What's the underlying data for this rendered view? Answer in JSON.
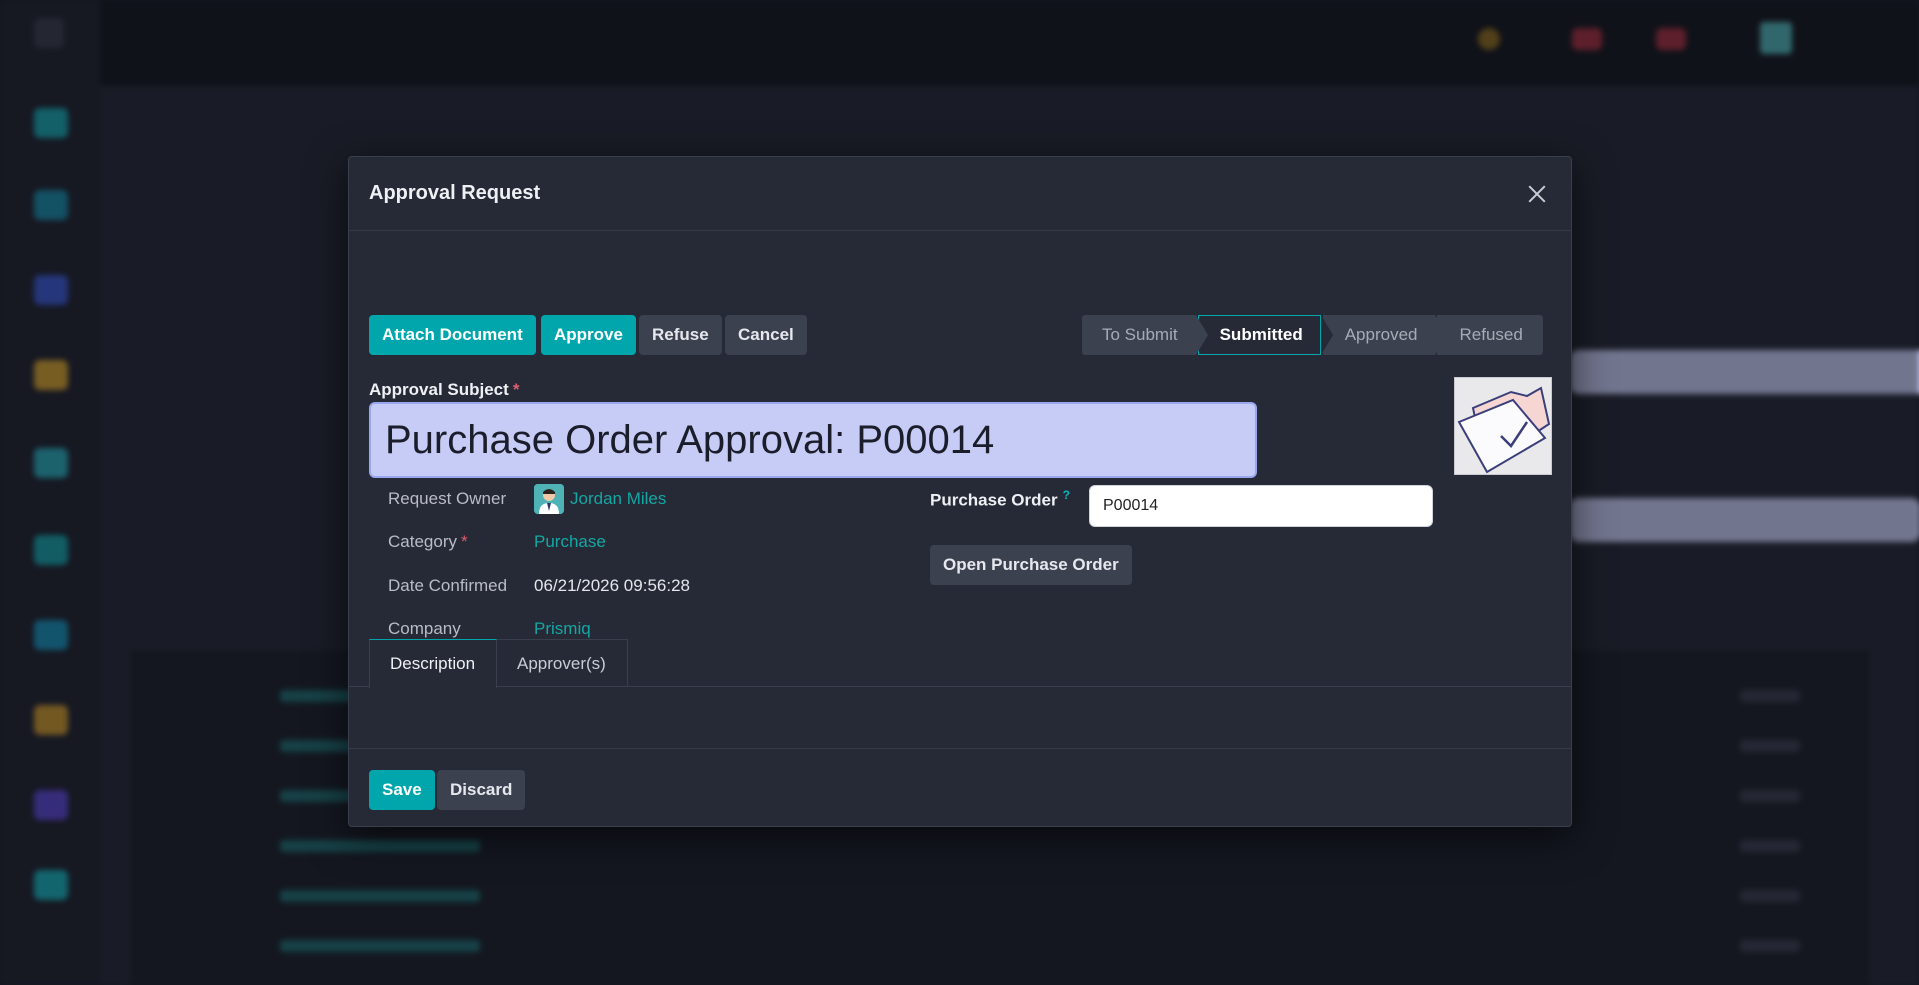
{
  "modal": {
    "title": "Approval Request"
  },
  "actions": {
    "attach_document": "Attach Document",
    "approve": "Approve",
    "refuse": "Refuse",
    "cancel": "Cancel"
  },
  "statusbar": {
    "stages": [
      "To Submit",
      "Submitted",
      "Approved",
      "Refused"
    ],
    "active": "Submitted"
  },
  "form": {
    "subject_label": "Approval Subject",
    "subject_value": "Purchase Order Approval: P00014",
    "request_owner_label": "Request Owner",
    "request_owner_value": "Jordan Miles",
    "category_label": "Category",
    "category_value": "Purchase",
    "date_confirmed_label": "Date Confirmed",
    "date_confirmed_value": "06/21/2026 09:56:28",
    "company_label": "Company",
    "company_value": "Prismiq",
    "purchase_order_label": "Purchase Order",
    "purchase_order_help": "?",
    "purchase_order_value": "P00014",
    "open_purchase_order": "Open Purchase Order",
    "required_marker": "*"
  },
  "tabs": {
    "description": "Description",
    "approvers": "Approver(s)"
  },
  "footer": {
    "save": "Save",
    "discard": "Discard"
  },
  "colors": {
    "primary": "#00a6ac",
    "link": "#14a7a3",
    "subject_bg": "#c6ccf6",
    "modal_bg": "#262a36"
  }
}
